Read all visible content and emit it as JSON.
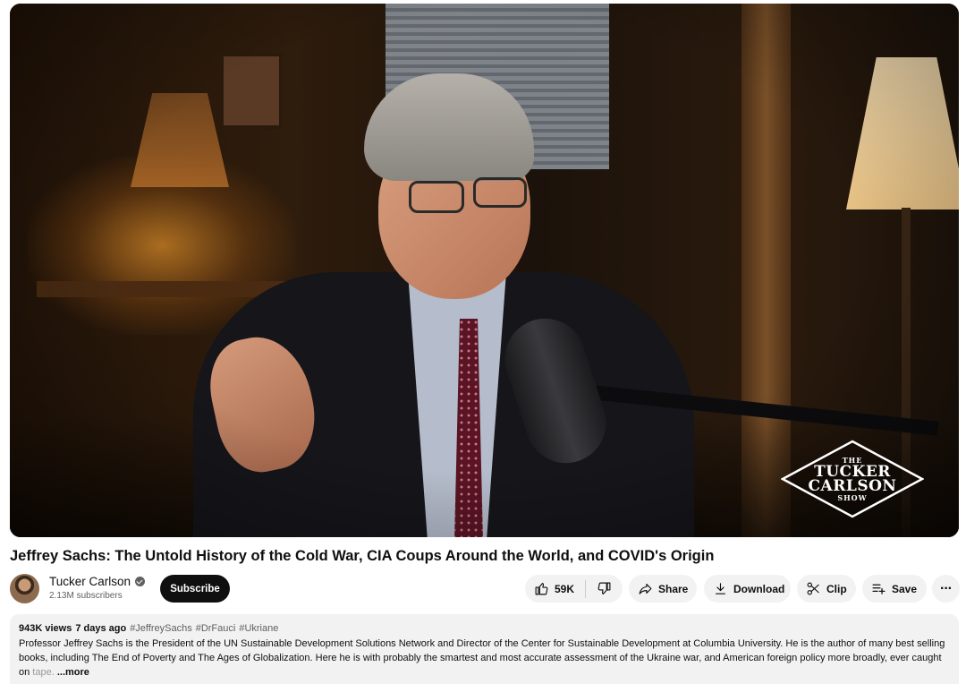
{
  "player": {
    "logo": {
      "small_top": "THE",
      "line1": "TUCKER",
      "line2": "CARLSON",
      "small_bottom": "SHOW"
    }
  },
  "video": {
    "title": "Jeffrey Sachs: The Untold History of the Cold War, CIA Coups Around the World, and COVID's Origin"
  },
  "channel": {
    "name": "Tucker Carlson",
    "subscribers": "2.13M subscribers",
    "subscribe_label": "Subscribe",
    "verified_icon": "verified-check-icon"
  },
  "actions": {
    "like_count": "59K",
    "share_label": "Share",
    "download_label": "Download",
    "clip_label": "Clip",
    "save_label": "Save",
    "more_label": "···"
  },
  "description": {
    "views": "943K views",
    "date": "7 days ago",
    "hashtags": [
      "#JeffreySachs",
      "#DrFauci",
      "#Ukriane"
    ],
    "text": "Professor Jeffrey Sachs is the President of the UN Sustainable Development Solutions Network and Director of the Center for Sustainable Development at Columbia University. He is the author of many best selling books, including The End of Poverty and The Ages of Globalization. Here he is with probably the smartest and most accurate assessment of the Ukraine war, and American foreign policy more broadly, ever caught on ",
    "faded_text": "tape.",
    "more_label": "...more"
  },
  "colors": {
    "subscribe_bg": "#0f0f0f",
    "pill_bg": "#f2f2f2",
    "secondary_text": "#606060"
  }
}
